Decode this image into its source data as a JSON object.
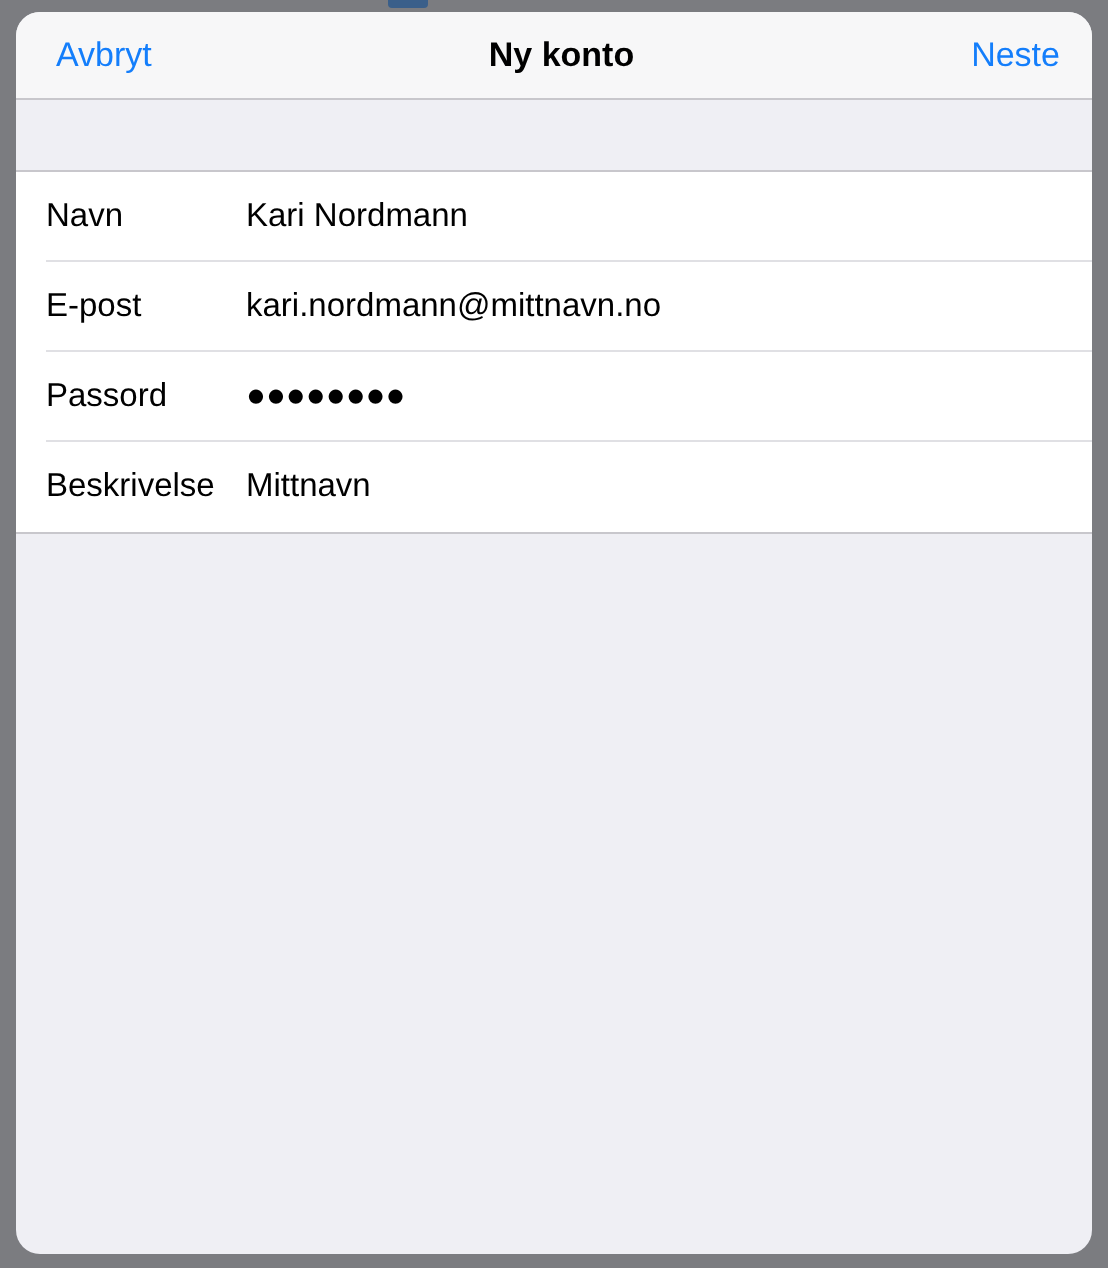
{
  "navbar": {
    "cancel": "Avbryt",
    "title": "Ny konto",
    "next": "Neste"
  },
  "fields": [
    {
      "label": "Navn",
      "value": "Kari Nordmann"
    },
    {
      "label": "E-post",
      "value": "kari.nordmann@mittnavn.no"
    },
    {
      "label": "Passord",
      "value": "●●●●●●●●"
    },
    {
      "label": "Beskrivelse",
      "value": "Mittnavn"
    }
  ]
}
